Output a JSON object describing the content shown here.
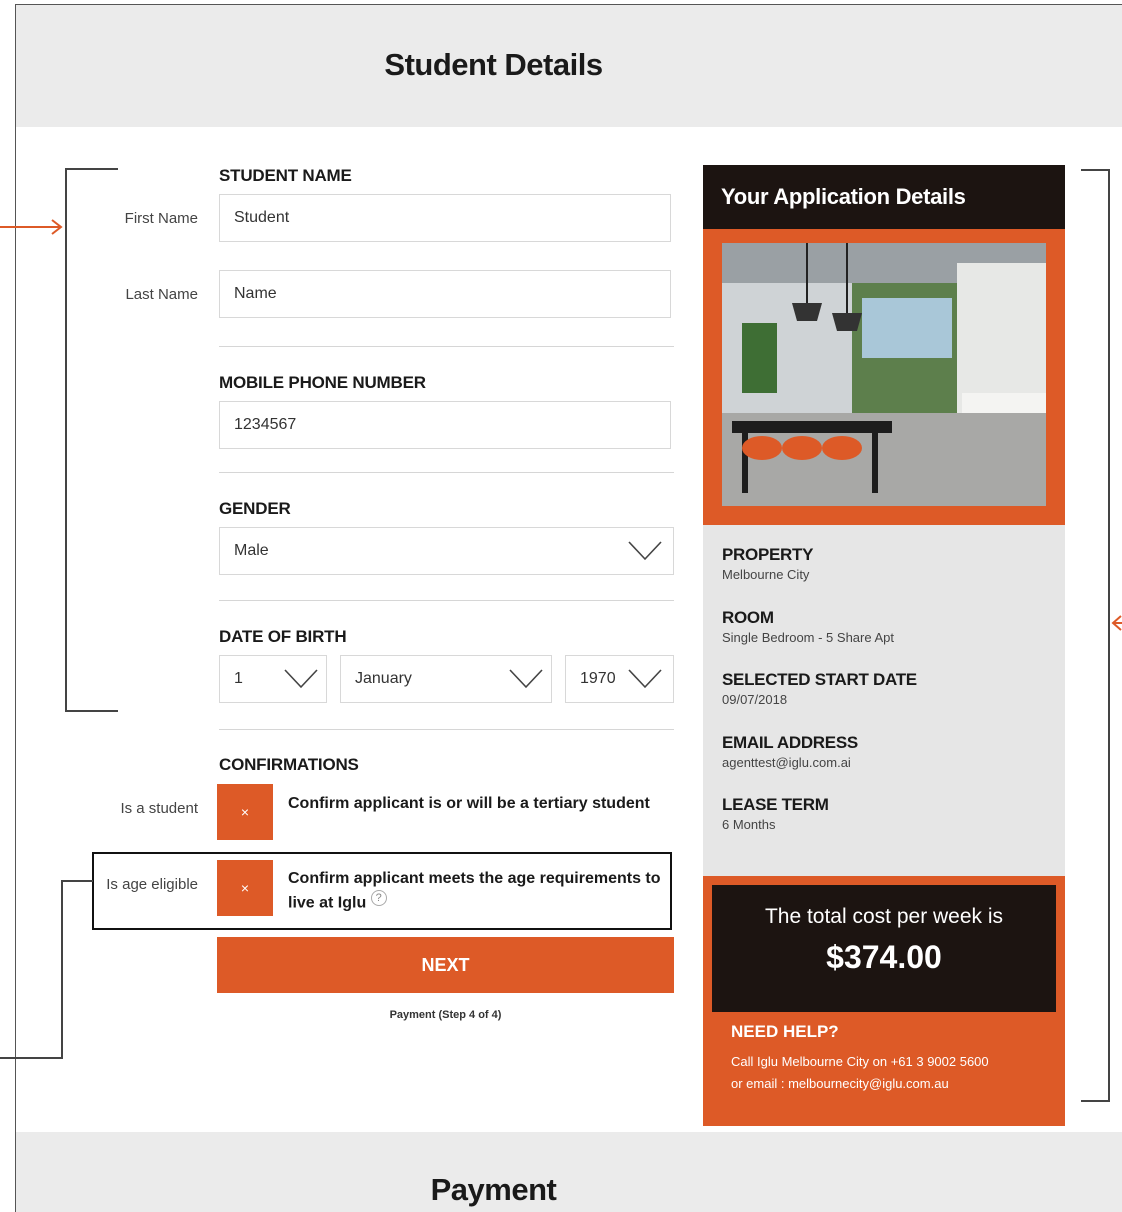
{
  "header": {
    "title": "Student Details"
  },
  "footer": {
    "title": "Payment"
  },
  "form": {
    "student_name": {
      "title": "STUDENT NAME",
      "first_name_label": "First Name",
      "first_name_value": "Student",
      "last_name_label": "Last Name",
      "last_name_value": "Name"
    },
    "mobile": {
      "title": "MOBILE PHONE NUMBER",
      "value": "1234567"
    },
    "gender": {
      "title": "GENDER",
      "value": "Male"
    },
    "dob": {
      "title": "DATE OF BIRTH",
      "day": "1",
      "month": "January",
      "year": "1970"
    },
    "confirmations": {
      "title": "CONFIRMATIONS",
      "student_label": "Is a student",
      "student_mark": "×",
      "student_text": "Confirm applicant is or will be a tertiary student",
      "age_label": "Is age eligible",
      "age_mark": "×",
      "age_text": "Confirm applicant meets the age requirements to live at Iglu",
      "age_help": "?"
    },
    "next_label": "NEXT",
    "step_note": "Payment (Step 4 of 4)"
  },
  "panel": {
    "title": "Your Application Details",
    "property_label": "PROPERTY",
    "property_value": "Melbourne City",
    "room_label": "ROOM",
    "room_value": "Single Bedroom - 5 Share Apt",
    "start_label": "SELECTED START DATE",
    "start_value": "09/07/2018",
    "email_label": "EMAIL ADDRESS",
    "email_value": "agenttest@iglu.com.ai",
    "lease_label": "LEASE TERM",
    "lease_value": "6 Months",
    "cost_line": "The total cost per week is",
    "cost_amount": "$374.00",
    "help_title": "NEED HELP?",
    "help_line1": "Call Iglu Melbourne City on +61 3 9002 5600",
    "help_line2": "or email : melbournecity@iglu.com.au"
  },
  "colors": {
    "accent": "#dd5a27",
    "dark": "#1c1411",
    "band": "#ebebeb",
    "annotation": "#444444"
  }
}
